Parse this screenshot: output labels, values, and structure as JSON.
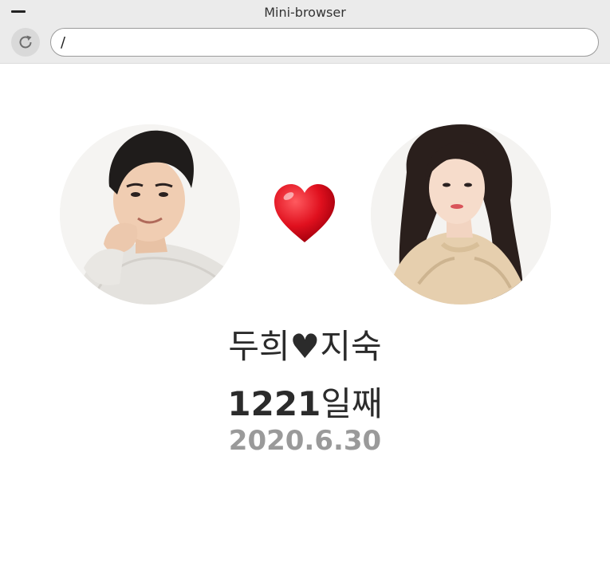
{
  "window": {
    "title": "Mini-browser",
    "url": "/"
  },
  "page": {
    "names": "두희♥지숙",
    "days_number": "1221",
    "days_suffix": "일째",
    "start_date": "2020.6.30"
  },
  "icons": {
    "minimize": "minimize-icon",
    "reload": "reload-icon",
    "heart": "heart-emoji"
  },
  "colors": {
    "heart": "#e0101e",
    "date": "#9a9a9a",
    "text": "#2b2b2b"
  }
}
